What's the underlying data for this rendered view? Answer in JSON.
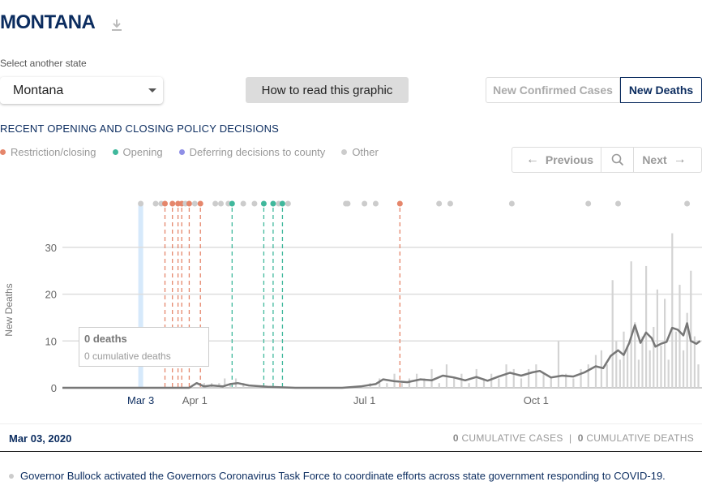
{
  "header": {
    "title": "MONTANA",
    "download_icon": "download-icon"
  },
  "state_select": {
    "label": "Select another state",
    "value": "Montana"
  },
  "how_button": {
    "label": "How to read this graphic"
  },
  "metric_toggle": {
    "options": [
      "New Confirmed Cases",
      "New Deaths"
    ],
    "selected": "New Deaths"
  },
  "policy": {
    "title": "RECENT OPENING AND CLOSING POLICY DECISIONS",
    "legend": [
      {
        "label": "Restriction/closing",
        "color": "#e5866b"
      },
      {
        "label": "Opening",
        "color": "#40b89c"
      },
      {
        "label": "Deferring decisions to county",
        "color": "#8f8fe6"
      },
      {
        "label": "Other",
        "color": "#cccccc"
      }
    ]
  },
  "nav": {
    "previous": "Previous",
    "next": "Next",
    "prev_icon": "arrow-left-icon",
    "search_icon": "search-icon",
    "next_icon": "arrow-right-icon"
  },
  "tooltip": {
    "main": "0 deaths",
    "sub": "0 cumulative deaths"
  },
  "footer": {
    "date": "Mar 03, 2020",
    "cum_cases_value": "0",
    "cum_cases_label": "CUMULATIVE CASES",
    "divider": "|",
    "cum_deaths_value": "0",
    "cum_deaths_label": "CUMULATIVE DEATHS"
  },
  "event": {
    "text": "Governor Bullock activated the Governors Coronavirus Task Force to coordinate efforts across state government responding to COVID-19."
  },
  "chart_data": {
    "type": "bar",
    "xlabel": "",
    "ylabel": "New Deaths",
    "ylim": [
      0,
      35
    ],
    "yticks": [
      0,
      10,
      20,
      30
    ],
    "x_ticks": [
      {
        "label": "Mar 3",
        "day": 42,
        "highlight": true
      },
      {
        "label": "Apr 1",
        "day": 71
      },
      {
        "label": "Jul 1",
        "day": 162
      },
      {
        "label": "Oct 1",
        "day": 254
      }
    ],
    "x_range_days": [
      0,
      343
    ],
    "x_origin": "2020-01-21",
    "selected_day": 42,
    "policy_markers": [
      {
        "day": 42,
        "type": "other"
      },
      {
        "day": 50,
        "type": "other"
      },
      {
        "day": 53,
        "type": "other"
      },
      {
        "day": 55,
        "type": "restriction"
      },
      {
        "day": 59,
        "type": "restriction"
      },
      {
        "day": 62,
        "type": "restriction"
      },
      {
        "day": 64,
        "type": "restriction"
      },
      {
        "day": 66,
        "type": "other"
      },
      {
        "day": 68,
        "type": "restriction"
      },
      {
        "day": 71,
        "type": "other"
      },
      {
        "day": 74,
        "type": "restriction"
      },
      {
        "day": 82,
        "type": "other"
      },
      {
        "day": 85,
        "type": "other"
      },
      {
        "day": 89,
        "type": "other"
      },
      {
        "day": 91,
        "type": "opening"
      },
      {
        "day": 97,
        "type": "other"
      },
      {
        "day": 103,
        "type": "other"
      },
      {
        "day": 108,
        "type": "opening"
      },
      {
        "day": 113,
        "type": "opening"
      },
      {
        "day": 116,
        "type": "other"
      },
      {
        "day": 118,
        "type": "opening"
      },
      {
        "day": 121,
        "type": "other"
      },
      {
        "day": 152,
        "type": "other"
      },
      {
        "day": 153,
        "type": "other"
      },
      {
        "day": 162,
        "type": "other"
      },
      {
        "day": 168,
        "type": "other"
      },
      {
        "day": 181,
        "type": "restriction"
      },
      {
        "day": 202,
        "type": "other"
      },
      {
        "day": 208,
        "type": "other"
      },
      {
        "day": 241,
        "type": "other"
      },
      {
        "day": 282,
        "type": "other"
      },
      {
        "day": 298,
        "type": "other"
      },
      {
        "day": 335,
        "type": "other"
      }
    ],
    "avg_line": [
      {
        "day": 0,
        "value": 0
      },
      {
        "day": 68,
        "value": 0
      },
      {
        "day": 72,
        "value": 1
      },
      {
        "day": 76,
        "value": 0.3
      },
      {
        "day": 80,
        "value": 0.5
      },
      {
        "day": 86,
        "value": 0.3
      },
      {
        "day": 90,
        "value": 0.8
      },
      {
        "day": 94,
        "value": 1.0
      },
      {
        "day": 100,
        "value": 0.5
      },
      {
        "day": 110,
        "value": 0.2
      },
      {
        "day": 125,
        "value": 0
      },
      {
        "day": 150,
        "value": 0
      },
      {
        "day": 160,
        "value": 0.3
      },
      {
        "day": 168,
        "value": 0.8
      },
      {
        "day": 172,
        "value": 1.8
      },
      {
        "day": 178,
        "value": 1.4
      },
      {
        "day": 185,
        "value": 1.2
      },
      {
        "day": 192,
        "value": 1.8
      },
      {
        "day": 198,
        "value": 1.6
      },
      {
        "day": 204,
        "value": 2.6
      },
      {
        "day": 210,
        "value": 2.2
      },
      {
        "day": 216,
        "value": 1.6
      },
      {
        "day": 222,
        "value": 2.3
      },
      {
        "day": 228,
        "value": 1.5
      },
      {
        "day": 234,
        "value": 2.4
      },
      {
        "day": 240,
        "value": 3.2
      },
      {
        "day": 246,
        "value": 2.6
      },
      {
        "day": 252,
        "value": 3.3
      },
      {
        "day": 256,
        "value": 3.6
      },
      {
        "day": 262,
        "value": 2.2
      },
      {
        "day": 268,
        "value": 2.6
      },
      {
        "day": 274,
        "value": 2.4
      },
      {
        "day": 280,
        "value": 3.3
      },
      {
        "day": 286,
        "value": 4.6
      },
      {
        "day": 290,
        "value": 4.2
      },
      {
        "day": 294,
        "value": 6.8
      },
      {
        "day": 298,
        "value": 8.0
      },
      {
        "day": 301,
        "value": 7.0
      },
      {
        "day": 304,
        "value": 9.6
      },
      {
        "day": 307,
        "value": 13.4
      },
      {
        "day": 310,
        "value": 9.6
      },
      {
        "day": 313,
        "value": 11.8
      },
      {
        "day": 316,
        "value": 10.6
      },
      {
        "day": 318,
        "value": 8.8
      },
      {
        "day": 321,
        "value": 9.4
      },
      {
        "day": 324,
        "value": 9.8
      },
      {
        "day": 327,
        "value": 12.8
      },
      {
        "day": 330,
        "value": 12.4
      },
      {
        "day": 333,
        "value": 11.2
      },
      {
        "day": 335,
        "value": 13.8
      },
      {
        "day": 337,
        "value": 10.0
      },
      {
        "day": 340,
        "value": 9.4
      },
      {
        "day": 342,
        "value": 10.0
      }
    ],
    "daily_values": [
      {
        "day": 76,
        "value": 1
      },
      {
        "day": 80,
        "value": 1
      },
      {
        "day": 84,
        "value": 1
      },
      {
        "day": 87,
        "value": 2
      },
      {
        "day": 90,
        "value": 1
      },
      {
        "day": 93,
        "value": 2
      },
      {
        "day": 97,
        "value": 1
      },
      {
        "day": 165,
        "value": 1
      },
      {
        "day": 170,
        "value": 2
      },
      {
        "day": 174,
        "value": 1
      },
      {
        "day": 178,
        "value": 3
      },
      {
        "day": 182,
        "value": 1
      },
      {
        "day": 186,
        "value": 2
      },
      {
        "day": 190,
        "value": 3
      },
      {
        "day": 194,
        "value": 2
      },
      {
        "day": 198,
        "value": 4
      },
      {
        "day": 202,
        "value": 1
      },
      {
        "day": 206,
        "value": 5
      },
      {
        "day": 210,
        "value": 2
      },
      {
        "day": 214,
        "value": 3
      },
      {
        "day": 218,
        "value": 1
      },
      {
        "day": 222,
        "value": 4
      },
      {
        "day": 226,
        "value": 2
      },
      {
        "day": 230,
        "value": 3
      },
      {
        "day": 234,
        "value": 2
      },
      {
        "day": 238,
        "value": 5
      },
      {
        "day": 242,
        "value": 4
      },
      {
        "day": 246,
        "value": 2
      },
      {
        "day": 250,
        "value": 4
      },
      {
        "day": 254,
        "value": 5
      },
      {
        "day": 258,
        "value": 3
      },
      {
        "day": 262,
        "value": 2
      },
      {
        "day": 266,
        "value": 10
      },
      {
        "day": 270,
        "value": 3
      },
      {
        "day": 274,
        "value": 2
      },
      {
        "day": 278,
        "value": 4
      },
      {
        "day": 282,
        "value": 5
      },
      {
        "day": 286,
        "value": 7
      },
      {
        "day": 289,
        "value": 8
      },
      {
        "day": 292,
        "value": 5
      },
      {
        "day": 295,
        "value": 23
      },
      {
        "day": 297,
        "value": 10
      },
      {
        "day": 299,
        "value": 6
      },
      {
        "day": 301,
        "value": 12
      },
      {
        "day": 303,
        "value": 9
      },
      {
        "day": 305,
        "value": 27
      },
      {
        "day": 307,
        "value": 14
      },
      {
        "day": 309,
        "value": 6
      },
      {
        "day": 311,
        "value": 11
      },
      {
        "day": 313,
        "value": 26
      },
      {
        "day": 315,
        "value": 8
      },
      {
        "day": 317,
        "value": 13
      },
      {
        "day": 319,
        "value": 21
      },
      {
        "day": 321,
        "value": 9
      },
      {
        "day": 323,
        "value": 19
      },
      {
        "day": 325,
        "value": 6
      },
      {
        "day": 327,
        "value": 33
      },
      {
        "day": 329,
        "value": 12
      },
      {
        "day": 331,
        "value": 22
      },
      {
        "day": 333,
        "value": 8
      },
      {
        "day": 335,
        "value": 16
      },
      {
        "day": 337,
        "value": 25
      },
      {
        "day": 339,
        "value": 11
      },
      {
        "day": 341,
        "value": 5
      }
    ]
  }
}
